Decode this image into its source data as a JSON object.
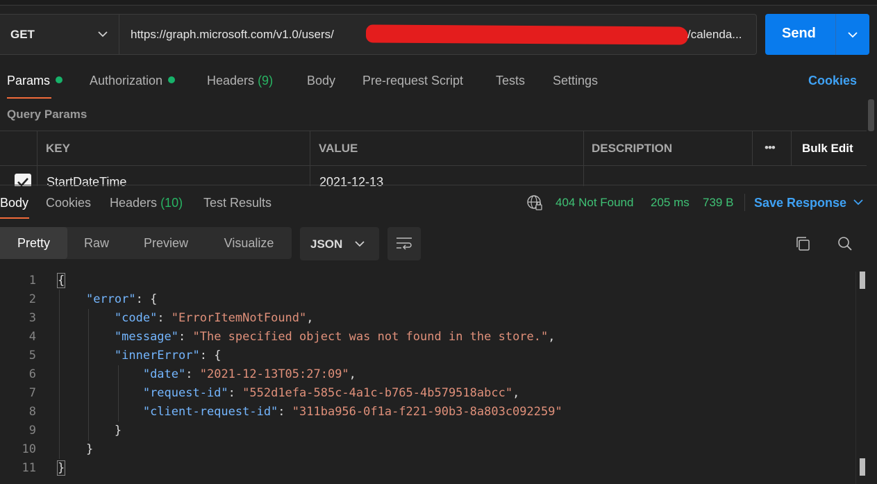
{
  "request": {
    "method": "GET",
    "url_prefix": "https://graph.microsoft.com/v1.0/users/",
    "url_suffix": "/calenda...",
    "send_label": "Send"
  },
  "request_tabs": {
    "params": "Params",
    "authorization": "Authorization",
    "headers": "Headers",
    "headers_count": "(9)",
    "body": "Body",
    "prerequest": "Pre-request Script",
    "tests": "Tests",
    "settings": "Settings",
    "cookies": "Cookies"
  },
  "query_params": {
    "title": "Query Params",
    "columns": {
      "key": "KEY",
      "value": "VALUE",
      "description": "DESCRIPTION",
      "more": "•••",
      "bulk_edit": "Bulk Edit"
    },
    "rows": [
      {
        "checked": true,
        "key": "StartDateTime",
        "value": "2021-12-13",
        "description": ""
      }
    ]
  },
  "response_tabs": {
    "body": "Body",
    "cookies": "Cookies",
    "headers": "Headers",
    "headers_count": "(10)",
    "test_results": "Test Results"
  },
  "response_status": {
    "status": "404 Not Found",
    "time": "205 ms",
    "size": "739 B",
    "save_response": "Save Response"
  },
  "view_modes": {
    "pretty": "Pretty",
    "raw": "Raw",
    "preview": "Preview",
    "visualize": "Visualize"
  },
  "format": "JSON",
  "code_lines": {
    "l1": "1",
    "l2": "2",
    "l3": "3",
    "l4": "4",
    "l5": "5",
    "l6": "6",
    "l7": "7",
    "l8": "8",
    "l9": "9",
    "l10": "10",
    "l11": "11",
    "open_brace": "{",
    "close_brace": "}",
    "k_error": "\"error\"",
    "k_code": "\"code\"",
    "v_code": "\"ErrorItemNotFound\"",
    "k_message": "\"message\"",
    "v_message": "\"The specified object was not found in the store.\"",
    "k_inner": "\"innerError\"",
    "k_date": "\"date\"",
    "v_date": "\"2021-12-13T05:27:09\"",
    "k_reqid": "\"request-id\"",
    "v_reqid": "\"552d1efa-585c-4a1c-b765-4b579518abcc\"",
    "k_clientid": "\"client-request-id\"",
    "v_clientid": "\"311ba956-0f1a-f221-90b3-8a803c092259\""
  },
  "colors": {
    "send_button": "#097bed",
    "accent_tab": "#f26b3a",
    "status_green": "#3fc275",
    "link_blue": "#3fa2f5",
    "json_key": "#74b6ff",
    "json_string": "#e0907a"
  }
}
